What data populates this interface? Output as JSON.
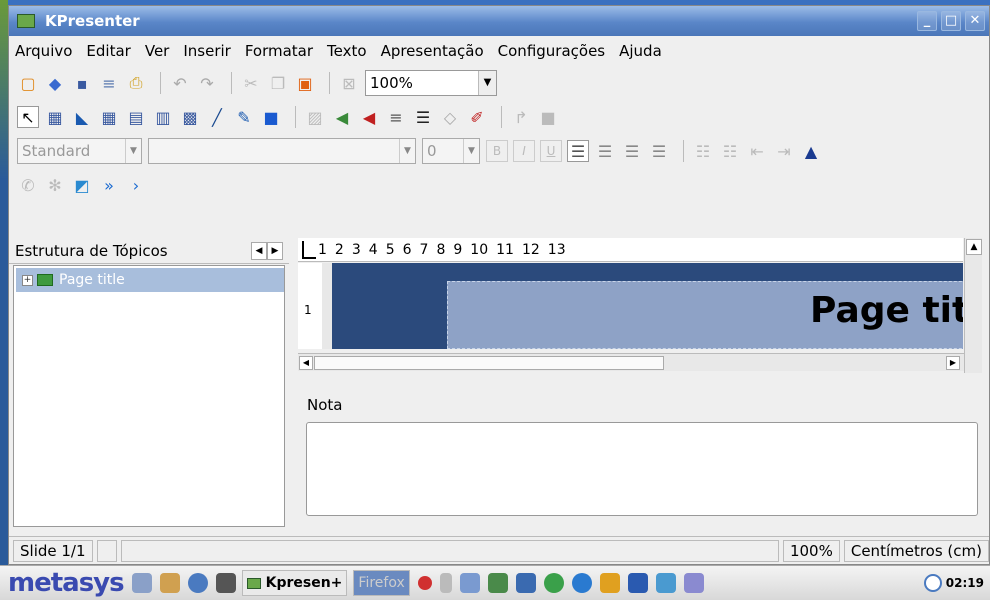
{
  "window": {
    "title": "KPresenter"
  },
  "menubar": [
    "Arquivo",
    "Editar",
    "Ver",
    "Inserir",
    "Formatar",
    "Texto",
    "Apresentação",
    "Configurações",
    "Ajuda"
  ],
  "toolbar": {
    "zoom": "100%",
    "style_combo": "Standard",
    "font_size": "0",
    "bold": "B",
    "italic": "I",
    "underline": "U"
  },
  "outline": {
    "tab_label": "Estrutura de Tópicos",
    "items": [
      {
        "label": "Page title"
      }
    ]
  },
  "ruler": {
    "h_marks": [
      "1",
      "2",
      "3",
      "4",
      "5",
      "6",
      "7",
      "8",
      "9",
      "10",
      "11",
      "12",
      "13"
    ],
    "v_mark": "1"
  },
  "slide": {
    "title": "Page title"
  },
  "notes": {
    "label": "Nota",
    "value": ""
  },
  "statusbar": {
    "slide": "Slide 1/1",
    "zoom": "100%",
    "unit": "Centímetros (cm)"
  },
  "taskbar": {
    "logo_main": "metasys",
    "tasks": [
      {
        "label": "Kpresen+"
      },
      {
        "label": "Firefox"
      }
    ],
    "clock": "02:19"
  },
  "colors": {
    "titlebar": "#5a86c8",
    "slide_bg": "#2b4a7c",
    "title_box": "#8ea2c6",
    "selection": "#a8bedc"
  }
}
